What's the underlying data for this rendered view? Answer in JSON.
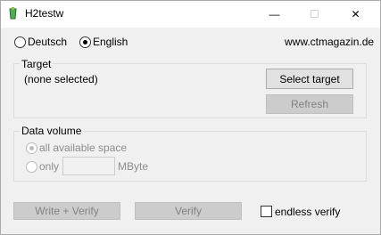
{
  "window": {
    "title": "H2testw",
    "controls": {
      "minimize": "—",
      "maximize": "☐",
      "close": "✕"
    }
  },
  "language": {
    "options": [
      "Deutsch",
      "English"
    ],
    "selected": "English",
    "website": "www.ctmagazin.de"
  },
  "target": {
    "group_label": "Target",
    "status": "(none selected)",
    "select_label": "Select target",
    "refresh_label": "Refresh"
  },
  "data_volume": {
    "group_label": "Data volume",
    "all_space_label": "all available space",
    "only_label": "only",
    "only_value": "",
    "unit": "MByte"
  },
  "actions": {
    "write_verify_label": "Write + Verify",
    "verify_label": "Verify",
    "endless_verify_label": "endless verify",
    "endless_verify_checked": false
  }
}
